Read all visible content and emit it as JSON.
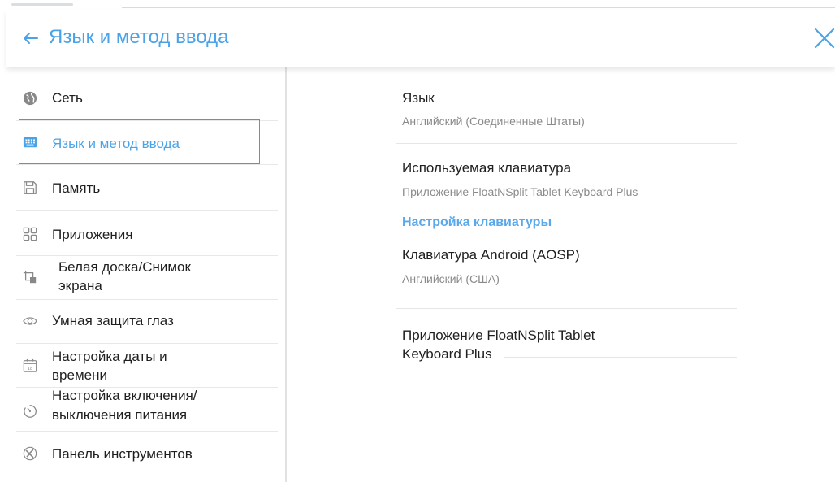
{
  "header": {
    "title": "Язык и метод ввода",
    "back_icon": "arrow-left-icon",
    "close_icon": "close-icon"
  },
  "sidebar": {
    "items": [
      {
        "label": "Сеть",
        "icon": "globe-icon"
      },
      {
        "label": "Язык и метод ввода",
        "icon": "keyboard-icon",
        "active": true
      },
      {
        "label": "Память",
        "icon": "save-icon"
      },
      {
        "label": "Приложения",
        "icon": "apps-grid-icon"
      },
      {
        "label_line1": "Белая доска/Снимок",
        "label_line2": "экрана",
        "icon": "crop-icon"
      },
      {
        "label": "Умная защита глаз",
        "icon": "eye-icon"
      },
      {
        "label_line1": "Настройка даты и",
        "label_line2": "времени",
        "icon": "calendar-icon",
        "calendar_day": "18"
      },
      {
        "label_line1": "Настройка включения/",
        "label_line2": "выключения питания",
        "icon": "timer-icon"
      },
      {
        "label": "Панель инструментов",
        "icon": "tools-icon"
      }
    ]
  },
  "content": {
    "language": {
      "title": "Язык",
      "value": "Английский (Соединенные Штаты)"
    },
    "current_keyboard": {
      "title": "Используемая клавиатура",
      "value": "Приложение FloatNSplit Tablet Keyboard Plus"
    },
    "keyboard_settings_header": "Настройка клавиатуры",
    "keyboards": [
      {
        "title": "Клавиатура Android (AOSP)",
        "value": "Английский (США)"
      },
      {
        "title_line1": "Приложение FloatNSplit Tablet",
        "title_line2": "Keyboard Plus"
      }
    ]
  },
  "colors": {
    "accent": "#4aa3e8",
    "section": "#5aa8ea",
    "active_border": "#e86060"
  }
}
